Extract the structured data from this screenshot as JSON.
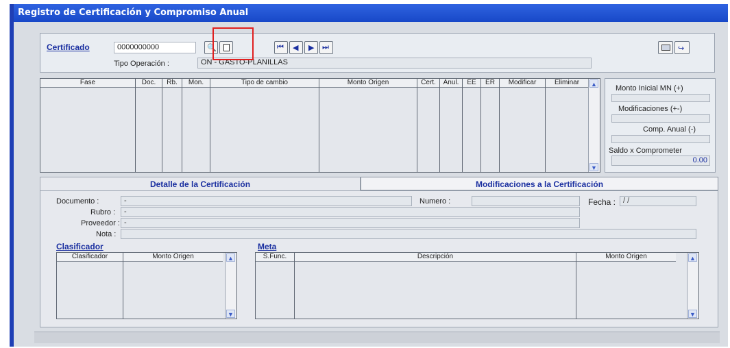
{
  "window": {
    "title": "Registro de Certificación y Compromiso Anual"
  },
  "header": {
    "certificado_label": "Certificado",
    "certificado_value": "0000000000",
    "tipo_operacion_label": "Tipo Operación :",
    "tipo_operacion_value": "ON - GASTO-PLANILLAS"
  },
  "toolbar": {
    "icons": [
      "search-binoculars-icon",
      "new-document-icon",
      "first-record-icon",
      "previous-record-icon",
      "next-record-icon",
      "last-record-icon",
      "report-icon",
      "exit-icon"
    ],
    "nav_glyphs": {
      "first": "⏮",
      "prev": "◀",
      "next": "▶",
      "last": "⏭"
    }
  },
  "main_grid": {
    "columns": [
      "Fase",
      "Doc.",
      "Rb.",
      "Mon.",
      "Tipo de cambio",
      "Monto Origen",
      "Cert.",
      "Anul.",
      "EE",
      "ER",
      "Modificar",
      "Eliminar"
    ]
  },
  "summary": {
    "monto_inicial_label": "Monto Inicial MN (+)",
    "modificaciones_label": "Modificaciones (+-)",
    "comp_anual_label": "Comp. Anual (-)",
    "saldo_label": "Saldo x Comprometer",
    "saldo_value": "0.00"
  },
  "tabs": {
    "detalle": "Detalle de la Certificación",
    "modificaciones": "Modificaciones a la Certificación"
  },
  "detail": {
    "documento_label": "Documento :",
    "documento_value": "-",
    "numero_label": "Numero :",
    "fecha_label": "Fecha :",
    "fecha_value": "/ /",
    "rubro_label": "Rubro :",
    "rubro_value": "-",
    "proveedor_label": "Proveedor :",
    "proveedor_value": "-",
    "nota_label": "Nota :"
  },
  "clasificador": {
    "title": "Clasificador",
    "columns": [
      "Clasificador",
      "Monto Origen"
    ]
  },
  "meta": {
    "title": "Meta",
    "columns": [
      "S.Func.",
      "Descripción",
      "Monto Origen"
    ]
  },
  "colors": {
    "title_bar": "#2f63e0",
    "link": "#1a2fa0",
    "highlight": "#e02020"
  }
}
